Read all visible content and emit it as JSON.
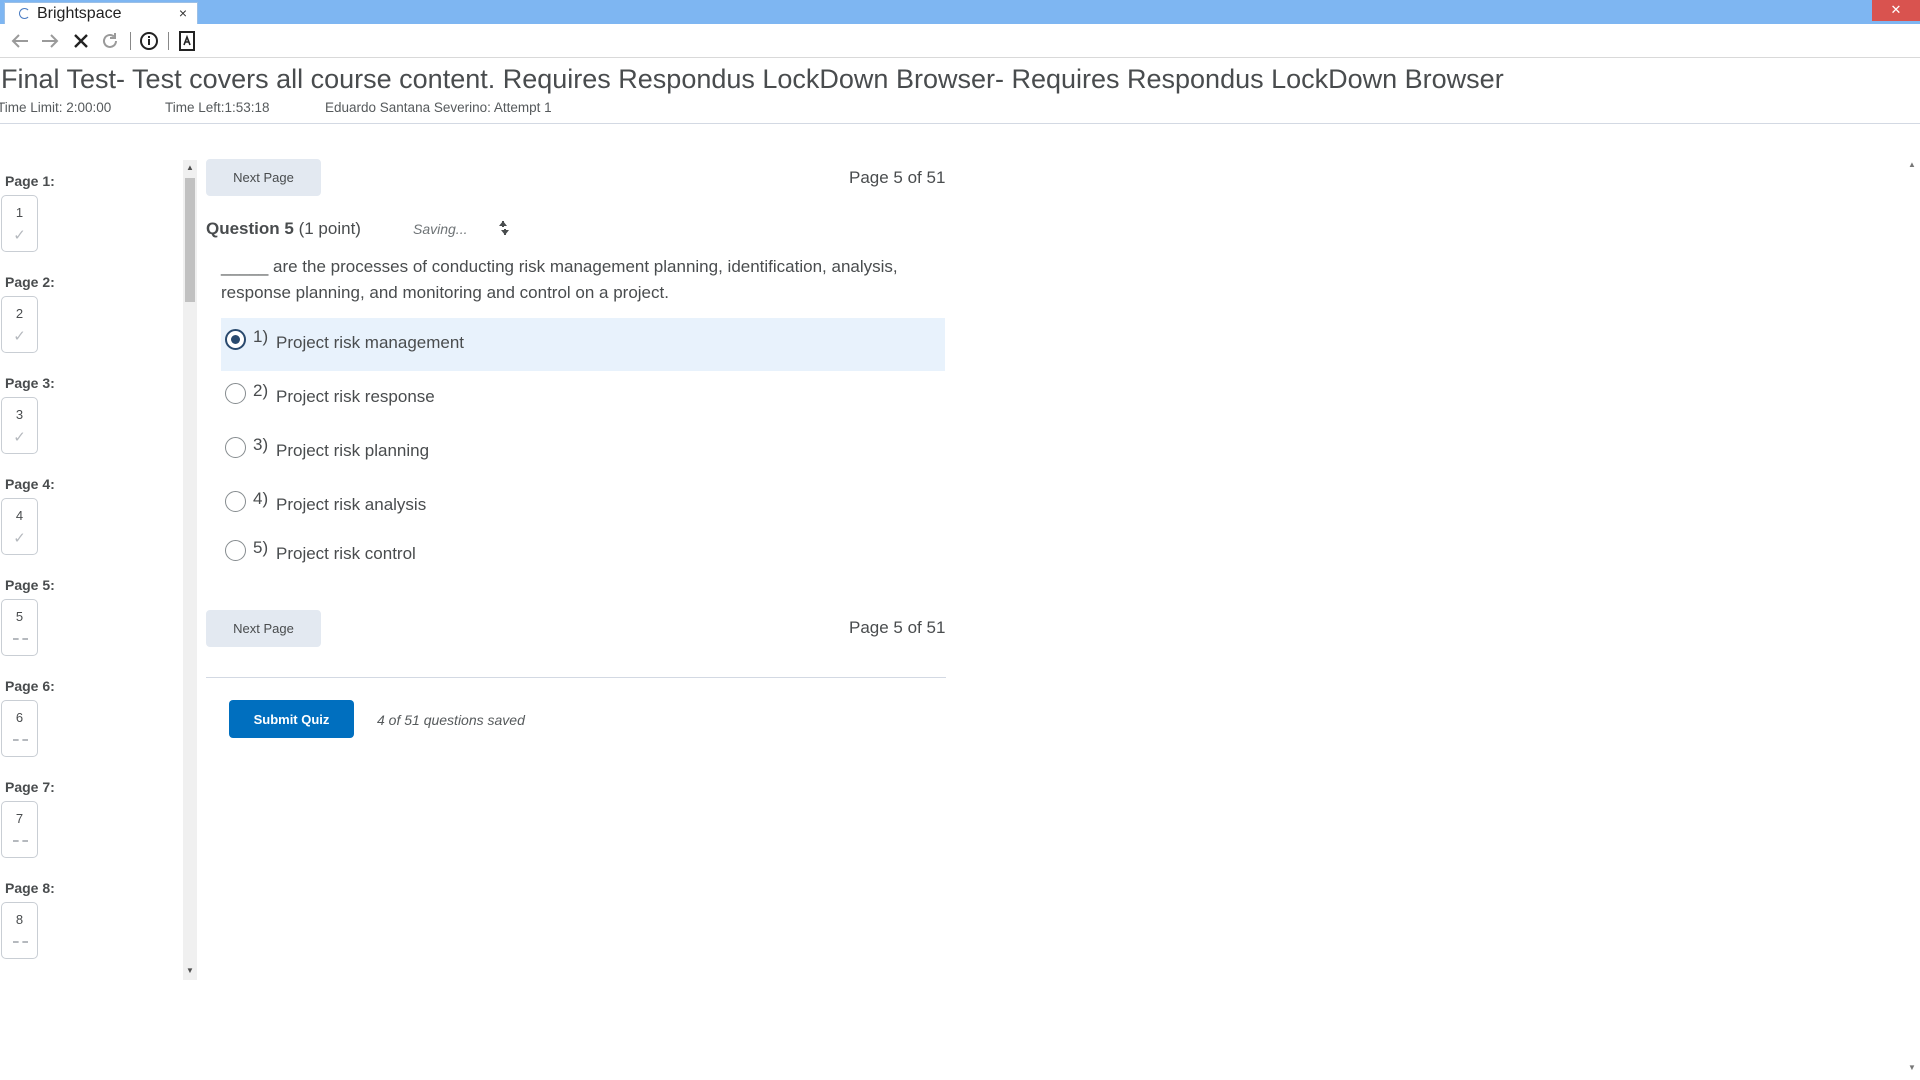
{
  "browser": {
    "tab_title": "Brightspace",
    "tab_close": "×",
    "window_close": "✕"
  },
  "header": {
    "title": "Final Test- Test covers all course content. Requires Respondus LockDown Browser- Requires Respondus LockDown Browser",
    "time_limit": "Time Limit: 2:00:00",
    "time_left": "Time Left:1:53:18",
    "attempt": "Eduardo Santana Severino: Attempt 1"
  },
  "nav": {
    "pages": [
      {
        "label": "Page 1:",
        "num": "1",
        "status": "answered"
      },
      {
        "label": "Page 2:",
        "num": "2",
        "status": "answered"
      },
      {
        "label": "Page 3:",
        "num": "3",
        "status": "answered"
      },
      {
        "label": "Page 4:",
        "num": "4",
        "status": "answered"
      },
      {
        "label": "Page 5:",
        "num": "5",
        "status": "unanswered"
      },
      {
        "label": "Page 6:",
        "num": "6",
        "status": "unanswered"
      },
      {
        "label": "Page 7:",
        "num": "7",
        "status": "unanswered"
      },
      {
        "label": "Page 8:",
        "num": "8",
        "status": "unanswered"
      }
    ]
  },
  "main": {
    "next_page_label": "Next Page",
    "page_indicator": "Page 5 of 51",
    "question_label": "Question 5",
    "question_points": "(1 point)",
    "saving_text": "Saving...",
    "question_text": "_____ are the processes of conducting risk management planning, identification, analysis, response planning, and monitoring and control on a project.",
    "options": [
      {
        "num": "1)",
        "text": "Project risk management",
        "selected": true
      },
      {
        "num": "2)",
        "text": "Project risk response",
        "selected": false
      },
      {
        "num": "3)",
        "text": "Project risk planning",
        "selected": false
      },
      {
        "num": "4)",
        "text": "Project risk analysis",
        "selected": false
      },
      {
        "num": "5)",
        "text": "Project risk control",
        "selected": false
      }
    ],
    "submit_label": "Submit Quiz",
    "saved_status": "4 of 51 questions saved"
  },
  "colors": {
    "primary": "#006fbf",
    "selected_bg": "#e8f2fc",
    "titlebar": "#7eb6f2"
  }
}
